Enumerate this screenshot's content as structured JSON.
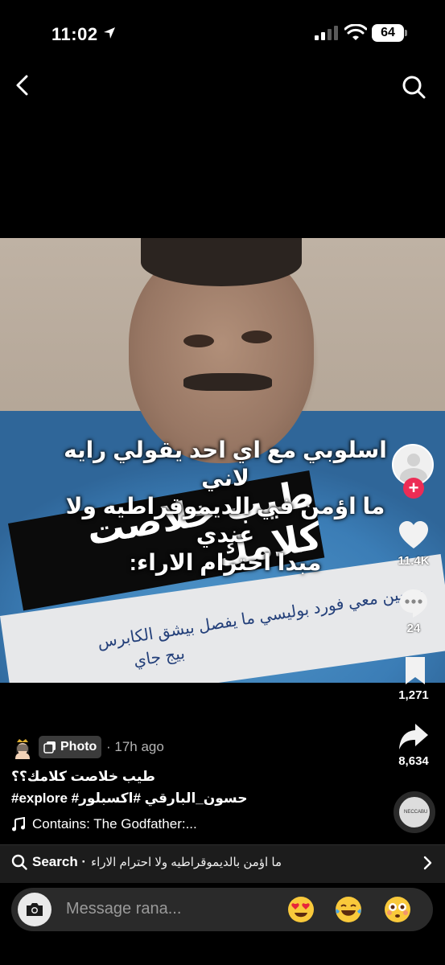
{
  "status_bar": {
    "time": "11:02",
    "battery": "64",
    "icons": [
      "location-arrow-icon",
      "cellular-signal-icon",
      "wifi-icon",
      "battery-icon"
    ]
  },
  "nav": {
    "back_icon": "chevron-left-icon",
    "search_icon": "search-icon"
  },
  "post": {
    "overlay_lines": [
      "اسلوبي مع اي احد يقولي رايه لاني",
      "ما اؤمن في الديموقراطيه ولا عندي",
      "مبدا احترام الاراء:"
    ],
    "sign_text": "طيب خلاصت كلامك",
    "paper_line1": "حسين معي فورد بوليسي ما يفصل بيشق الكابرس",
    "paper_line2": "بيج جاي"
  },
  "rail": {
    "likes": "11.4K",
    "comments": "24",
    "saves": "1,271",
    "shares": "8,634",
    "follow_symbol": "+"
  },
  "caption": {
    "photo_label": "Photo",
    "time_ago": "· 17h ago",
    "text": "طيب خلاصت كلامك؟؟",
    "hashtags": "#explore #حسون_البارقي #اكسبلور",
    "music": "Contains: The Godfather:...",
    "music_thumb_text": "NECCABU"
  },
  "search": {
    "label": "Search ·",
    "query": "ما اؤمن بالديموقراطيه ولا احترام الاراء"
  },
  "comment_bar": {
    "placeholder": "Message rana...",
    "emojis": [
      "heart-eyes-emoji",
      "tears-of-joy-emoji",
      "flushed-emoji"
    ]
  },
  "colors": {
    "background": "#000000",
    "accent_red": "#ec2c55",
    "badge_bg": "#3b3b3b",
    "search_bar_bg": "#1c1c1c"
  }
}
